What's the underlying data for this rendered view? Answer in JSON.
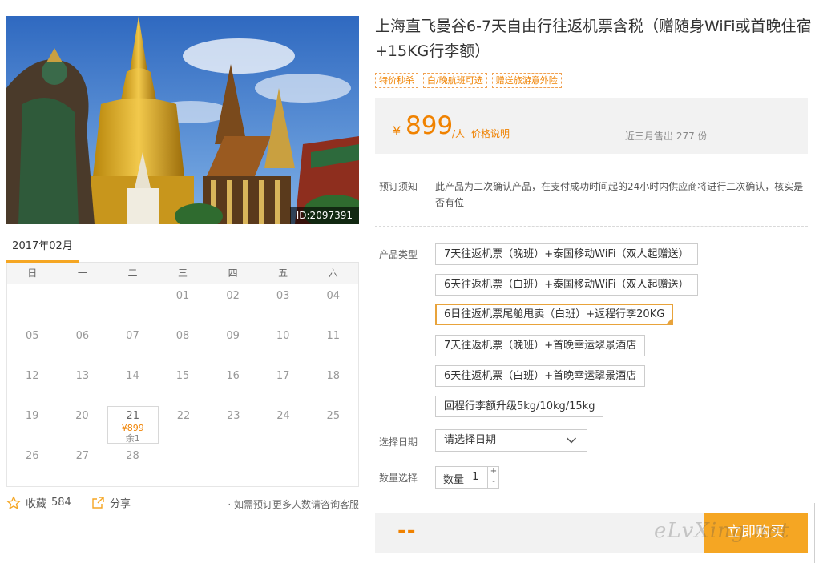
{
  "product": {
    "image_id": "ID:2097391",
    "title": "上海直飞曼谷6-7天自由行往返机票含税（赠随身WiFi或首晚住宿+15KG行李额）",
    "tags": [
      "特价秒杀",
      "白/晚航班可选",
      "赠送旅游意外险"
    ]
  },
  "price": {
    "currency": "¥",
    "amount": "899",
    "unit": "/人",
    "note_link": "价格说明",
    "sold_text": "近三月售出 277 份"
  },
  "notice": {
    "label": "预订须知",
    "text": "此产品为二次确认产品，在支付成功时间起的24小时内供应商将进行二次确认，核实是否有位"
  },
  "product_type": {
    "label": "产品类型",
    "options": [
      "7天往返机票（晚班）+泰国移动WiFi（双人起赠送）",
      "6天往返机票（白班）+泰国移动WiFi（双人起赠送）",
      "6日往返机票尾舱甩卖（白班）+返程行李20KG",
      "7天往返机票（晚班）+首晚幸运翠景酒店",
      "6天往返机票（白班）+首晚幸运翠景酒店",
      "回程行李额升级5kg/10kg/15kg"
    ],
    "selected_index": 2
  },
  "date": {
    "label": "选择日期",
    "placeholder": "请选择日期"
  },
  "quantity": {
    "label": "数量选择",
    "text": "数量",
    "value": "1",
    "plus": "+",
    "minus": "-"
  },
  "calendar": {
    "month": "2017年02月",
    "weekdays": [
      "日",
      "一",
      "二",
      "三",
      "四",
      "五",
      "六"
    ],
    "weeks": [
      [
        "",
        "",
        "",
        "01",
        "02",
        "03",
        "04"
      ],
      [
        "05",
        "06",
        "07",
        "08",
        "09",
        "10",
        "11"
      ],
      [
        "12",
        "13",
        "14",
        "15",
        "16",
        "17",
        "18"
      ],
      [
        "19",
        "20",
        "21",
        "22",
        "23",
        "24",
        "25"
      ],
      [
        "26",
        "27",
        "28",
        "",
        "",
        "",
        ""
      ]
    ],
    "available": {
      "date": "21",
      "price": "¥899",
      "stock": "余1"
    }
  },
  "footer": {
    "favorite_label": "收藏",
    "favorite_count": "584",
    "share_label": "分享",
    "consult_text": "· 如需预订更多人数请咨询客服"
  },
  "order": {
    "total": "--",
    "buy_label": "立即购买"
  },
  "watermark": "eLvXing.net",
  "colors": {
    "accent": "#f08200",
    "button": "#f5a623",
    "panel": "#f2f2f2"
  }
}
